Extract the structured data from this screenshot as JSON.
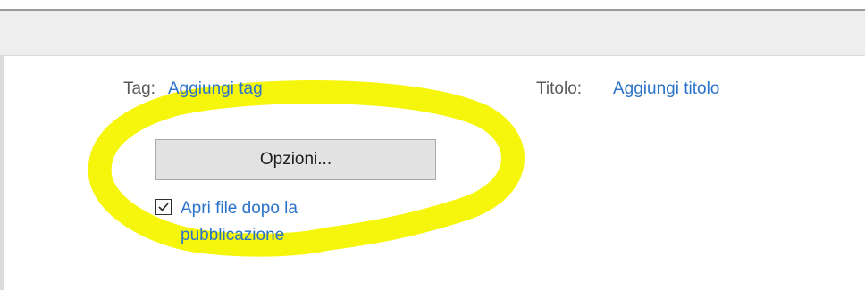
{
  "properties": {
    "tag_label": "Tag:",
    "tag_link": "Aggiungi tag",
    "title_label": "Titolo:",
    "title_link": "Aggiungi titolo"
  },
  "options_button": {
    "label": "Opzioni..."
  },
  "open_after_publish": {
    "checked": true,
    "label": "Apri file dopo la pubblicazione"
  },
  "colors": {
    "link": "#2b73c8",
    "highlight": "#f5f500"
  },
  "icons": {
    "checkbox": "checkmark-icon"
  }
}
